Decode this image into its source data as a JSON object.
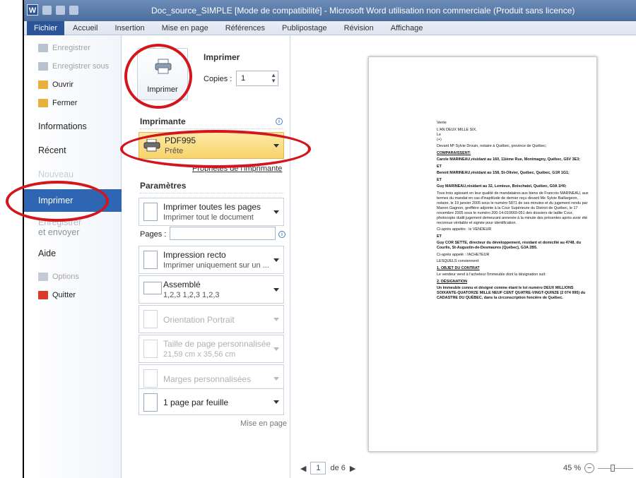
{
  "window": {
    "title": "Doc_source_SIMPLE [Mode de compatibilité] - Microsoft Word utilisation non commerciale (Produit sans licence)",
    "app_icon": "W"
  },
  "ribbon_tabs": [
    "Fichier",
    "Accueil",
    "Insertion",
    "Mise en page",
    "Références",
    "Publipostage",
    "Révision",
    "Affichage"
  ],
  "backstage": {
    "save": "Enregistrer",
    "save_as": "Enregistrer sous",
    "open": "Ouvrir",
    "close": "Fermer",
    "info": "Informations",
    "recent": "Récent",
    "new": "Nouveau",
    "print": "Imprimer",
    "share_1": "Enregistrer",
    "share_2": "et envoyer",
    "help": "Aide",
    "options": "Options",
    "exit": "Quitter"
  },
  "print": {
    "heading": "Imprimer",
    "button_label": "Imprimer",
    "copies_label": "Copies :",
    "copies_value": "1",
    "printer_heading": "Imprimante",
    "printer_name": "PDF995",
    "printer_status": "Prête",
    "printer_properties": "Propriétés de l'imprimante",
    "settings_heading": "Paramètres",
    "pages_scope_title": "Imprimer toutes les pages",
    "pages_scope_sub": "Imprimer tout le document",
    "pages_label": "Pages :",
    "pages_value": "",
    "sides_title": "Impression recto",
    "sides_sub": "Imprimer uniquement sur un ...",
    "collate_title": "Assemblé",
    "collate_sub": "1,2,3   1,2,3   1,2,3",
    "orientation": "Orientation Portrait",
    "paper_title": "Taille de page personnalisée",
    "paper_sub": "21,59 cm x 35,56 cm",
    "margins": "Marges personnalisées",
    "per_sheet": "1 page par feuille",
    "page_setup_link": "Mise en page"
  },
  "preview": {
    "lines": [
      {
        "t": "Vente",
        "c": ""
      },
      {
        "t": "L'AN DEUX MILLE SIX,\nLe\n(+)",
        "c": ""
      },
      {
        "t": "Devant Mº Sylvie Drouin, notaire à Québec, province de Québec;",
        "c": ""
      },
      {
        "t": "COMPARAISSENT:",
        "c": "u"
      },
      {
        "t": "Carole MARINEAU,résidant au 160, 11ième Rue, Montmagny, Québec, G5V 3E3;",
        "c": "b"
      },
      {
        "t": "ET",
        "c": "b"
      },
      {
        "t": "Benoit MARINEAU,résidant au 158, St-Olivier, Québec, Québec, G1R 1G1;",
        "c": "b"
      },
      {
        "t": "ET",
        "c": "b"
      },
      {
        "t": "Guy MARINEAU,résidant au 32, Lemieux, Boischatel, Québec, G0A 1H0;",
        "c": "b"
      },
      {
        "t": "Tous trois agissant en leur qualité de mandataires aux biens de Francois MARINEAU, aux termes du mandat en cas d'inaptitude de dernier reçu devant Me Sylvie Baillargeon, notaire, le 19 janvier 2005 sous le numéro 5871 de ses minutes et du jugement rendu par Manon Gagnon, greffière adjointe à la Cour Supérieure du District de Québec, le 17 novembre 2005 sous le numéro 200-14-010669-051 des dossiers de ladite Cour, photocopie dudit jugement demeurant annexée à la minute des présentes après avoir été reconnue véritable et signée pour identification.",
        "c": ""
      },
      {
        "t": "Ci-après appelés : le VENDEUR",
        "c": ""
      },
      {
        "t": "ET",
        "c": "b"
      },
      {
        "t": "Guy COR SETTE, directeur du développement, résidant et domicilié au 4748, du Courlis, St-Augustin-de-Desmaures (Québec), G3A 2B5.",
        "c": "b"
      },
      {
        "t": "Ci-après appelé : l'ACHETEUR",
        "c": ""
      },
      {
        "t": "LESQUELS conviennent:",
        "c": ""
      },
      {
        "t": "1.      OBJET DU CONTRAT",
        "c": "u"
      },
      {
        "t": "Le vendeur vend à l'acheteur l'immeuble dont la désignation suit:",
        "c": ""
      },
      {
        "t": "2.      DÉSIGNATION",
        "c": "u"
      },
      {
        "t": "Un immeuble connu et désigné comme étant le lot numéro DEUX MILLIONS SOIXANTE-QUATORZE MILLE NEUF CENT QUATRE-VINGT-QUINZE (2 074 995) du CADASTRE DU QUÉBEC, dans la circonscription foncière de Québec.",
        "c": "b"
      }
    ]
  },
  "status": {
    "current_page": "1",
    "page_total": "de 6",
    "zoom": "45 %"
  }
}
